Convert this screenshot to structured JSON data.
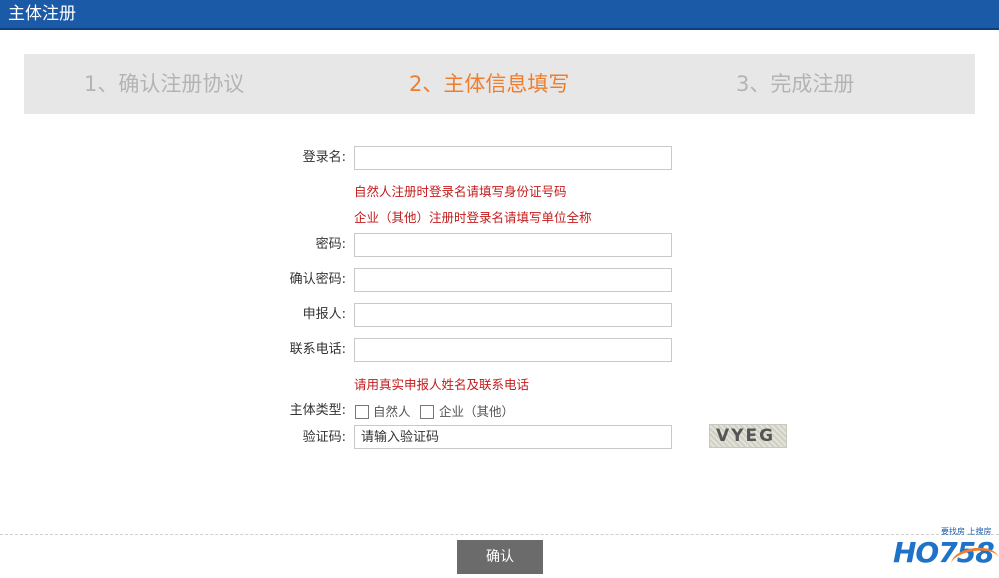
{
  "header": {
    "title": "主体注册"
  },
  "steps": [
    {
      "label": "1、确认注册协议",
      "state": "inactive"
    },
    {
      "label": "2、主体信息填写",
      "state": "active"
    },
    {
      "label": "3、完成注册",
      "state": "inactive"
    }
  ],
  "form": {
    "login_name": {
      "label": "登录名:",
      "value": ""
    },
    "login_hint_1": "自然人注册时登录名请填写身份证号码",
    "login_hint_2": "企业（其他）注册时登录名请填写单位全称",
    "password": {
      "label": "密码:",
      "value": ""
    },
    "confirm_password": {
      "label": "确认密码:",
      "value": ""
    },
    "applicant": {
      "label": "申报人:",
      "value": ""
    },
    "phone": {
      "label": "联系电话:",
      "value": ""
    },
    "contact_hint": "请用真实申报人姓名及联系电话",
    "entity_type": {
      "label": "主体类型:",
      "options": [
        {
          "label": "自然人",
          "checked": false
        },
        {
          "label": "企业（其他）",
          "checked": false
        }
      ]
    },
    "captcha": {
      "label": "验证码:",
      "placeholder": "请输入验证码",
      "image_text": "VYEG"
    }
  },
  "footer": {
    "confirm_label": "确认"
  },
  "logo": {
    "tagline": "要找房 上搜房",
    "mark": "HO758"
  },
  "colors": {
    "header": "#1a5aa6",
    "active_step": "#f07d2c",
    "hint": "#c41b1b"
  }
}
